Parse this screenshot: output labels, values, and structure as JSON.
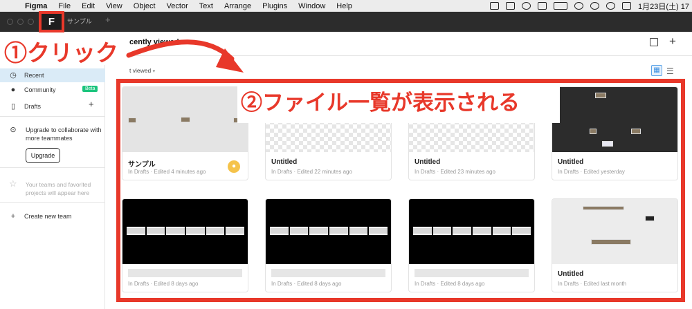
{
  "menubar": {
    "apple": "",
    "items": [
      "Figma",
      "File",
      "Edit",
      "View",
      "Object",
      "Vector",
      "Text",
      "Arrange",
      "Plugins",
      "Window",
      "Help"
    ],
    "clock": "1月23日(土) 17"
  },
  "titlebar": {
    "home_icon": "F",
    "tab_label": "サンプル",
    "new_tab": "+"
  },
  "sidebar": {
    "recent": "Recent",
    "community": "Community",
    "beta": "Beta",
    "drafts": "Drafts",
    "upgrade_text": "Upgrade to collaborate with more teammates",
    "upgrade_button": "Upgrade",
    "teams_text": "Your teams and favorited projects will appear here",
    "create_team": "Create new team"
  },
  "main": {
    "title": "cently viewed",
    "sort_label": "t viewed",
    "add": "+"
  },
  "cards": [
    {
      "name": "サンプル",
      "meta": "In Drafts · Edited 4 minutes ago"
    },
    {
      "name": "Untitled",
      "meta": "In Drafts · Edited 22 minutes ago"
    },
    {
      "name": "Untitled",
      "meta": "In Drafts · Edited 23 minutes ago"
    },
    {
      "name": "Untitled",
      "meta": "In Drafts · Edited yesterday"
    },
    {
      "name": "",
      "meta": "In Drafts · Edited 8 days ago"
    },
    {
      "name": "",
      "meta": "In Drafts · Edited 8 days ago"
    },
    {
      "name": "",
      "meta": "In Drafts · Edited 8 days ago"
    },
    {
      "name": "Untitled",
      "meta": "In Drafts · Edited last month"
    }
  ],
  "annotations": {
    "step1": "①クリック",
    "step2": "②ファイル一覧が表示される",
    "color": "#e8382a"
  },
  "icons": {
    "recent": "clock-icon",
    "community": "globe-icon",
    "drafts": "file-icon",
    "upgrade": "arrow-up-circle-icon",
    "teams": "star-icon",
    "create": "plus-icon"
  }
}
